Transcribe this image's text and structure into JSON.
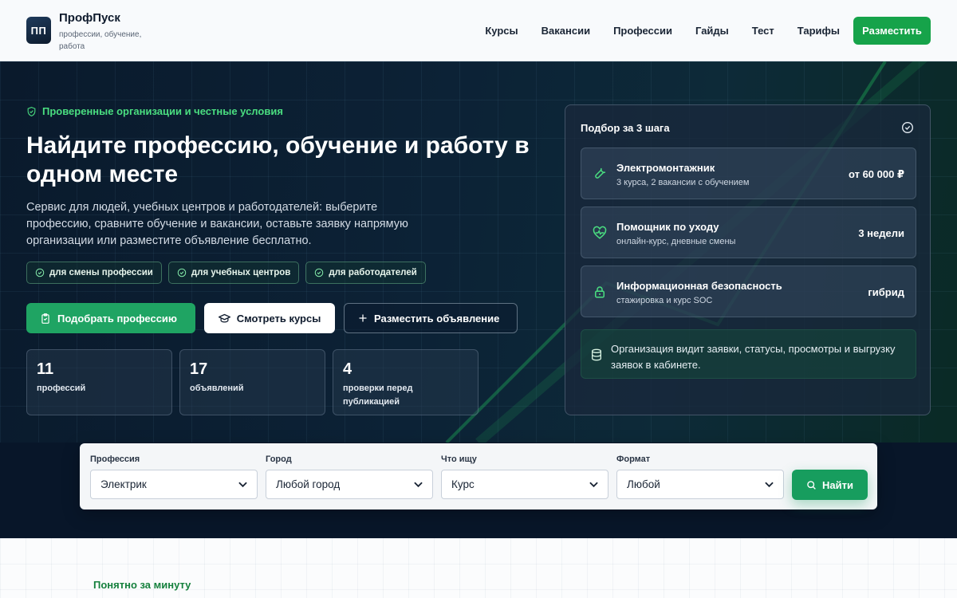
{
  "header": {
    "logo_text": "ПП",
    "brand_name": "ПрофПуск",
    "tagline": "профессии, обучение, работа",
    "nav": [
      "Курсы",
      "Вакансии",
      "Профессии",
      "Гайды",
      "Тест",
      "Тарифы"
    ],
    "cta": "Разместить"
  },
  "hero": {
    "badge": "Проверенные организации и честные условия",
    "title": "Найдите профессию, обучение и работу в одном месте",
    "description": "Сервис для людей, учебных центров и работодателей: выберите профессию, сравните обучение и вакансии, оставьте заявку напрямую организации или разместите объявление бесплатно.",
    "pills": [
      "для смены профессии",
      "для учебных центров",
      "для работодателей"
    ],
    "buttons": {
      "primary": "Подобрать профессию",
      "secondary": "Смотреть курсы",
      "outline": "Разместить объявление"
    },
    "stats": [
      {
        "num": "11",
        "label": "профессий"
      },
      {
        "num": "17",
        "label": "объявлений"
      },
      {
        "num": "4",
        "label": "проверки перед публикацией"
      }
    ]
  },
  "panel": {
    "title": "Подбор за 3 шага",
    "cards": [
      {
        "title": "Электромонтажник",
        "sub": "3 курса, 2 вакансии с обучением",
        "value": "от 60 000 ₽",
        "icon": "wrench-icon"
      },
      {
        "title": "Помощник по уходу",
        "sub": "онлайн-курс, дневные смены",
        "value": "3 недели",
        "icon": "heart-pulse-icon"
      },
      {
        "title": "Информационная безопасность",
        "sub": "стажировка и курс SOC",
        "value": "гибрид",
        "icon": "lock-icon"
      }
    ],
    "note": "Организация видит заявки, статусы, просмотры и выгрузку заявок в кабинете."
  },
  "search": {
    "fields": [
      {
        "label": "Профессия",
        "value": "Электрик"
      },
      {
        "label": "Город",
        "value": "Любой город"
      },
      {
        "label": "Что ищу",
        "value": "Курс"
      },
      {
        "label": "Формат",
        "value": "Любой"
      }
    ],
    "button": "Найти"
  },
  "lower": {
    "label": "Понятно за минуту"
  },
  "colors": {
    "accent": "#16a34a",
    "accent_text": "#4ade80",
    "hero_bg": "#0c2236"
  }
}
